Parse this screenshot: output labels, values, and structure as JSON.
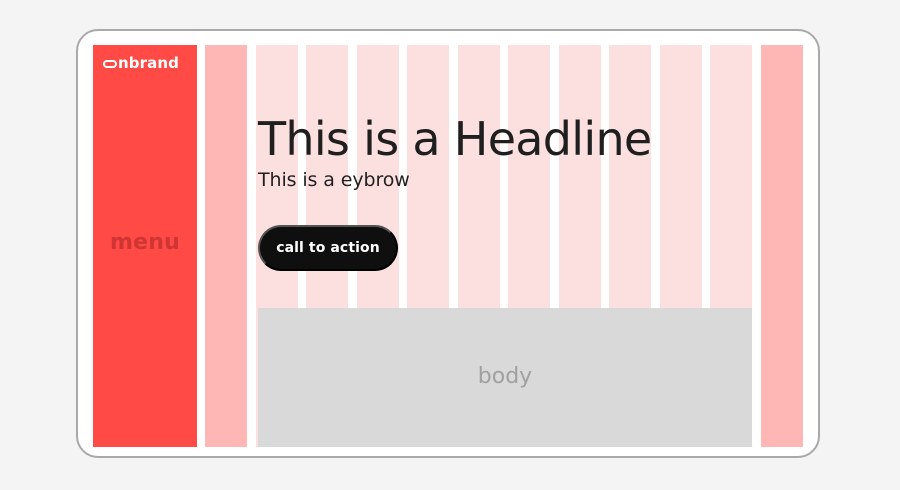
{
  "brand": {
    "logo_text": "nbrand"
  },
  "menu": {
    "label": "menu"
  },
  "hero": {
    "headline": "This is a Headline",
    "eyebrow": "This is a eybrow",
    "cta_label": "call to action"
  },
  "body": {
    "label": "body"
  },
  "colors": {
    "page_background": "#f4f4f4",
    "device_border": "#a9a9a9",
    "menu_fill": "#ff4a45",
    "menu_text": "#cf3533",
    "gutter_fill": "#ffb7b6",
    "column_fill": "#fbe0df",
    "body_fill": "#d9d9d9",
    "body_text": "#a0a0a0",
    "headline_text": "#1f1f1f",
    "cta_fill": "#0f0f0f",
    "cta_text": "#ffffff"
  },
  "icons": {
    "logo_mark": "brand-logo-icon"
  }
}
